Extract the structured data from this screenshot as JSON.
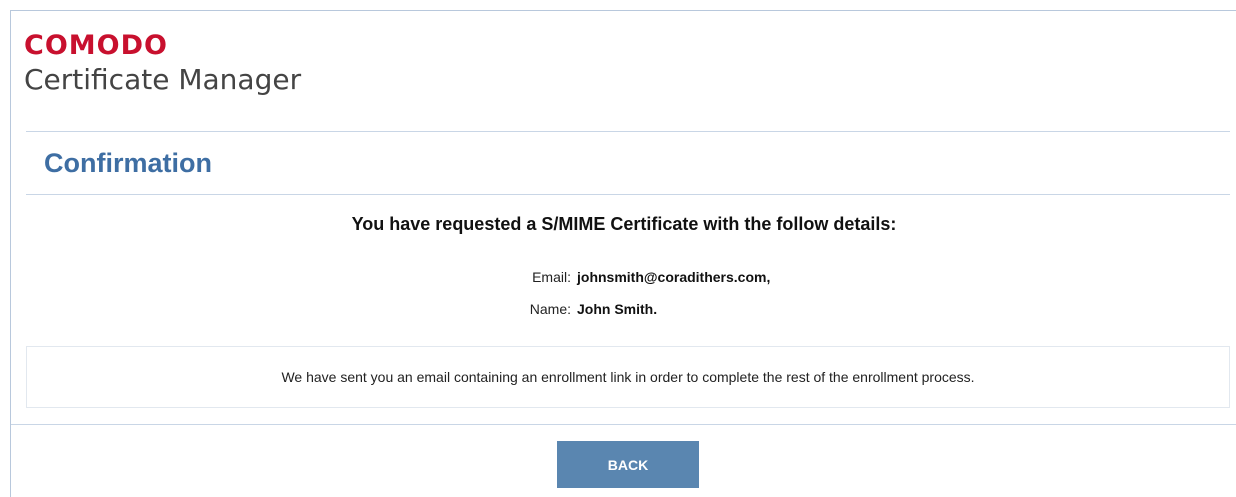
{
  "brand": {
    "name": "COMODO",
    "product": "Certificate Manager"
  },
  "page": {
    "title": "Confirmation"
  },
  "request": {
    "heading": "You have requested a S/MIME Certificate with the follow details:",
    "email_label": "Email:",
    "email_value": "johnsmith@coradithers.com,",
    "name_label": "Name:",
    "name_value": "John Smith."
  },
  "notice": {
    "text": "We have sent you an email containing an enrollment link in order to complete the rest of the enrollment process."
  },
  "actions": {
    "back_label": "BACK"
  },
  "colors": {
    "brand_red": "#c8102e",
    "title_blue": "#3e6ea3",
    "button_blue": "#5a86b0"
  }
}
